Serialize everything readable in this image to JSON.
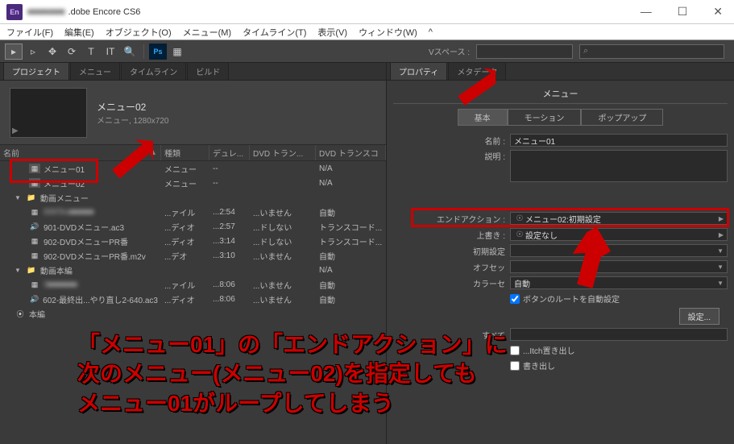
{
  "titlebar": {
    "app_icon": "En",
    "document": "■■■■■■■",
    "app_name": ".dobe Encore CS6",
    "min": "—",
    "max": "☐",
    "close": "✕"
  },
  "menubar": {
    "file": "ファイル(F)",
    "edit": "編集(E)",
    "object": "オブジェクト(O)",
    "menu": "メニュー(M)",
    "timeline": "タイムライン(T)",
    "view": "表示(V)",
    "window": "ウィンドウ(W)",
    "help": "^"
  },
  "toolbar": {
    "workspace_label": "Vスペース :",
    "search_glyph": "⌕"
  },
  "left": {
    "tabs": [
      "プロジェクト",
      "メニュー",
      "タイムライン",
      "ビルド"
    ],
    "preview": {
      "title": "メニュー02",
      "sub": "メニュー, 1280x720"
    },
    "cols": {
      "name": "名前",
      "type": "種類",
      "dur": "デュレ...",
      "tr1": "DVD トラン...",
      "tr2": "DVD トランスコ"
    },
    "rows": [
      {
        "icon": "menu",
        "name": "メニュー01",
        "type": "メニュー",
        "dur": "--",
        "tr1": "",
        "tr2": "N/A",
        "ind": 1
      },
      {
        "icon": "menu",
        "name": "メニュー02",
        "type": "メニュー",
        "dur": "--",
        "tr1": "",
        "tr2": "N/A",
        "ind": 1
      },
      {
        "icon": "folder",
        "name": "動画メニュー",
        "type": "",
        "dur": "",
        "tr1": "",
        "tr2": "",
        "ind": 0,
        "folder": true
      },
      {
        "icon": "video",
        "name": "006Tes■■■■■",
        "type": "...ァイル",
        "dur": "...2:54",
        "tr1": "...いません",
        "tr2": "自動",
        "ind": 1,
        "blur": true
      },
      {
        "icon": "audio",
        "name": "901-DVDメニュー.ac3",
        "type": "...ディオ",
        "dur": "...2:57",
        "tr1": "...ドしない",
        "tr2": "トランスコード...",
        "ind": 1
      },
      {
        "icon": "video",
        "name": "902-DVDメニューPR番",
        "type": "...ディオ",
        "dur": "...3:14",
        "tr1": "...ドしない",
        "tr2": "トランスコード...",
        "ind": 1
      },
      {
        "icon": "video",
        "name": "902-DVDメニューPR番.m2v",
        "type": "...デオ",
        "dur": "...3:10",
        "tr1": "...いません",
        "tr2": "自動",
        "ind": 1
      },
      {
        "icon": "folder",
        "name": "動画本編",
        "type": "",
        "dur": "",
        "tr1": "",
        "tr2": "N/A",
        "ind": 0,
        "folder": true
      },
      {
        "icon": "video",
        "name": "3■■■■■■",
        "type": "...ァイル",
        "dur": "...8:06",
        "tr1": "...いません",
        "tr2": "自動",
        "ind": 1,
        "blur": true
      },
      {
        "icon": "audio",
        "name": "602-最終出...やり直し2-640.ac3",
        "type": "...ディオ",
        "dur": "...8:06",
        "tr1": "...いません",
        "tr2": "自動",
        "ind": 1
      },
      {
        "icon": "disc",
        "name": "本編",
        "type": "",
        "dur": "",
        "tr1": "",
        "tr2": "",
        "ind": 0
      }
    ]
  },
  "right": {
    "tabs": [
      "プロパティ",
      "メタデータ"
    ],
    "header": "メニュー",
    "ptabs": [
      "基本",
      "モーション",
      "ポップアップ"
    ],
    "name_label": "名前 :",
    "name_value": "メニュー01",
    "desc_label": "説明 :",
    "endaction_label": "エンドアクション :",
    "endaction_value": "メニュー02:初期設定",
    "override_label": "上書き :",
    "override_value": "設定なし",
    "defset_label": "初期設定",
    "offset_label": "オフセッ",
    "colorset_label": "カラーセ",
    "colorset_value": "自動",
    "chk_label": "ボタンのルートを自動設定",
    "set_btn": "設定...",
    "extra1": "すべて",
    "extra2": "...Itch置き出し",
    "extra3": "書き出し"
  },
  "annotation": {
    "l1": "「メニュー01」の「エンドアクション」に",
    "l2": "次のメニュー(メニュー02)を指定しても",
    "l3": "メニュー01がループしてしまう"
  }
}
